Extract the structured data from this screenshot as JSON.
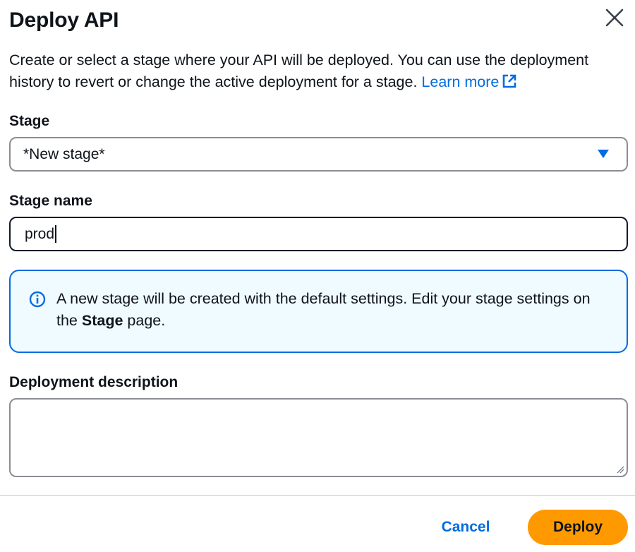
{
  "dialog": {
    "title": "Deploy API",
    "intro_text": "Create or select a stage where your API will be deployed. You can use the deployment history to revert or change the active deployment for a stage. ",
    "learn_more_label": "Learn more"
  },
  "stage": {
    "label": "Stage",
    "selected_value": "*New stage*"
  },
  "stage_name": {
    "label": "Stage name",
    "value": "prod"
  },
  "info": {
    "text_before": "A new stage will be created with the default settings. Edit your stage settings on the ",
    "bold_text": "Stage",
    "text_after": " page."
  },
  "description": {
    "label": "Deployment description",
    "value": ""
  },
  "footer": {
    "cancel_label": "Cancel",
    "deploy_label": "Deploy"
  },
  "colors": {
    "link": "#006ce0",
    "primary_button": "#ff9900",
    "info_background": "#f0fbff",
    "info_border": "#006ce0"
  },
  "icons": {
    "close": "close-icon",
    "external_link": "external-link-icon",
    "dropdown": "caret-down-icon",
    "info": "info-icon",
    "resize": "resize-handle-icon"
  }
}
